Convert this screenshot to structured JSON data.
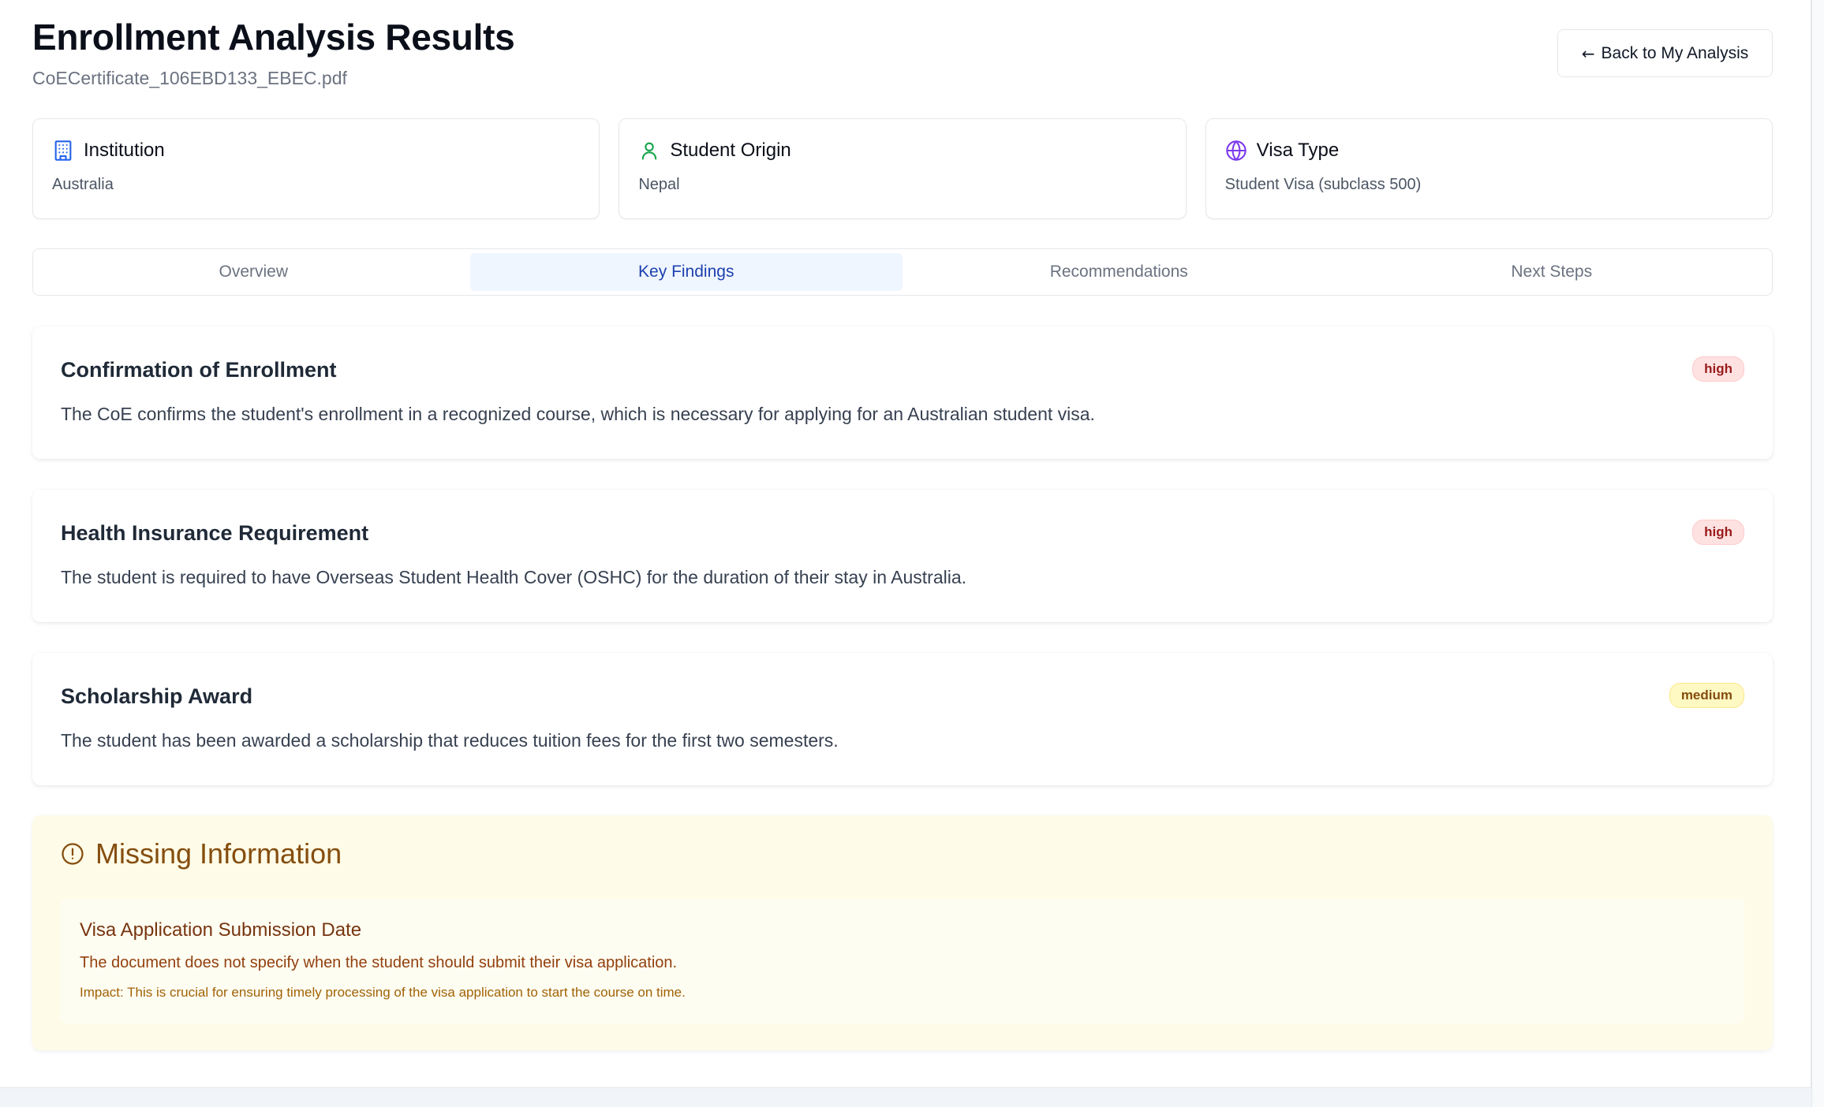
{
  "header": {
    "title": "Enrollment Analysis Results",
    "file_name": "CoECertificate_106EBD133_EBEC.pdf",
    "back_button": "Back to My Analysis"
  },
  "info_cards": [
    {
      "title": "Institution",
      "value": "Australia",
      "icon": "building-icon",
      "icon_color": "#2563eb"
    },
    {
      "title": "Student Origin",
      "value": "Nepal",
      "icon": "user-icon",
      "icon_color": "#16a34a"
    },
    {
      "title": "Visa Type",
      "value": "Student Visa (subclass 500)",
      "icon": "globe-icon",
      "icon_color": "#7c3aed"
    }
  ],
  "tabs": [
    {
      "label": "Overview",
      "active": false
    },
    {
      "label": "Key Findings",
      "active": true
    },
    {
      "label": "Recommendations",
      "active": false
    },
    {
      "label": "Next Steps",
      "active": false
    }
  ],
  "findings": [
    {
      "title": "Confirmation of Enrollment",
      "description": "The CoE confirms the student's enrollment in a recognized course, which is necessary for applying for an Australian student visa.",
      "priority": "high"
    },
    {
      "title": "Health Insurance Requirement",
      "description": "The student is required to have Overseas Student Health Cover (OSHC) for the duration of their stay in Australia.",
      "priority": "high"
    },
    {
      "title": "Scholarship Award",
      "description": "The student has been awarded a scholarship that reduces tuition fees for the first two semesters.",
      "priority": "medium"
    }
  ],
  "missing_information": {
    "title": "Missing Information",
    "items": [
      {
        "title": "Visa Application Submission Date",
        "description": "The document does not specify when the student should submit their visa application.",
        "impact": "Impact: This is crucial for ensuring timely processing of the visa application to start the course on time."
      }
    ]
  }
}
